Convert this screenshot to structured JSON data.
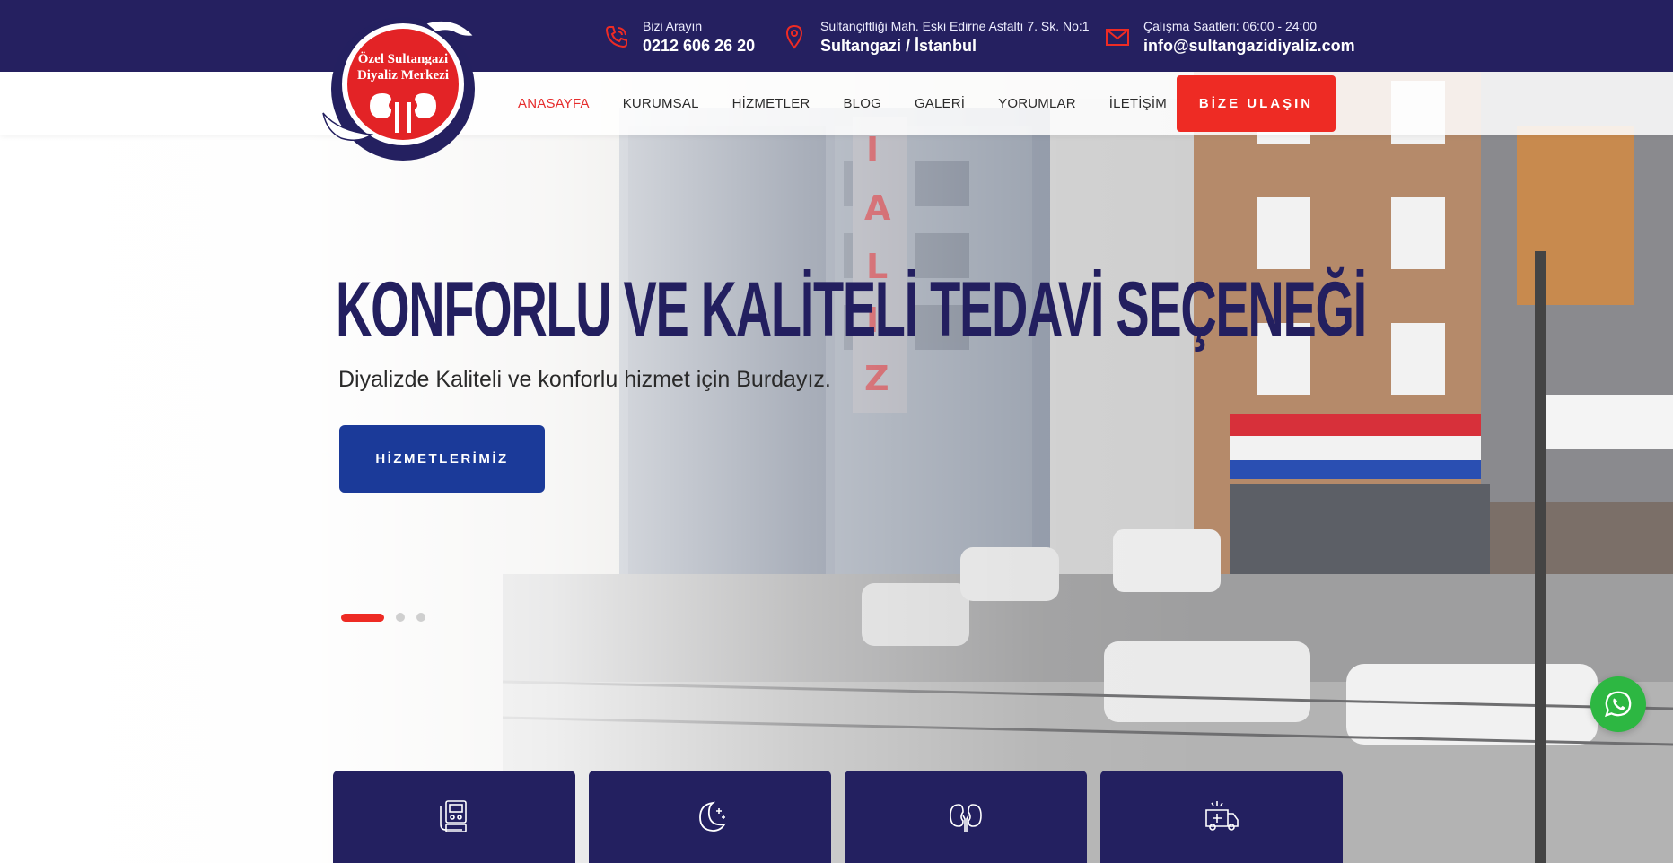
{
  "colors": {
    "top_bar": "#252060",
    "accent_red": "#ee2b24",
    "hero_button": "#1b3a99",
    "card_bg": "#232060",
    "title_text": "#231f5f",
    "whatsapp": "#2db742"
  },
  "logo": {
    "line1": "Özel Sultangazi",
    "line2": "Diyaliz Merkezi"
  },
  "top_bar": {
    "phone": {
      "icon": "phone-icon",
      "label": "Bizi Arayın",
      "value": "0212 606 26 20"
    },
    "address": {
      "icon": "location-pin-icon",
      "label": "Sultançiftliği Mah. Eski Edirne Asfaltı 7. Sk. No:1",
      "value": "Sultangazi / İstanbul"
    },
    "hours": {
      "icon": "mail-icon",
      "label": "Çalışma Saatleri: 06:00 - 24:00",
      "value": "info@sultangazidiyaliz.com"
    }
  },
  "nav": {
    "items": [
      "ANASAYFA",
      "KURUMSAL",
      "HİZMETLER",
      "BLOG",
      "GALERİ",
      "YORUMLAR",
      "İLETİŞİM"
    ],
    "active_index": 0,
    "cta_label": "BİZE ULAŞIN"
  },
  "hero": {
    "title": "KONFORLU VE KALİTELİ TEDAVİ SEÇENEĞİ",
    "subtitle": "Diyalizde Kaliteli ve konforlu hizmet için Burdayız.",
    "button_label": "HİZMETLERİMİZ",
    "slides_count": 3,
    "active_slide": 0
  },
  "service_cards": [
    {
      "icon": "dialysis-machine-icon"
    },
    {
      "icon": "moon-icon"
    },
    {
      "icon": "kidneys-icon"
    },
    {
      "icon": "ambulance-icon"
    }
  ],
  "whatsapp": {
    "icon": "whatsapp-icon"
  }
}
